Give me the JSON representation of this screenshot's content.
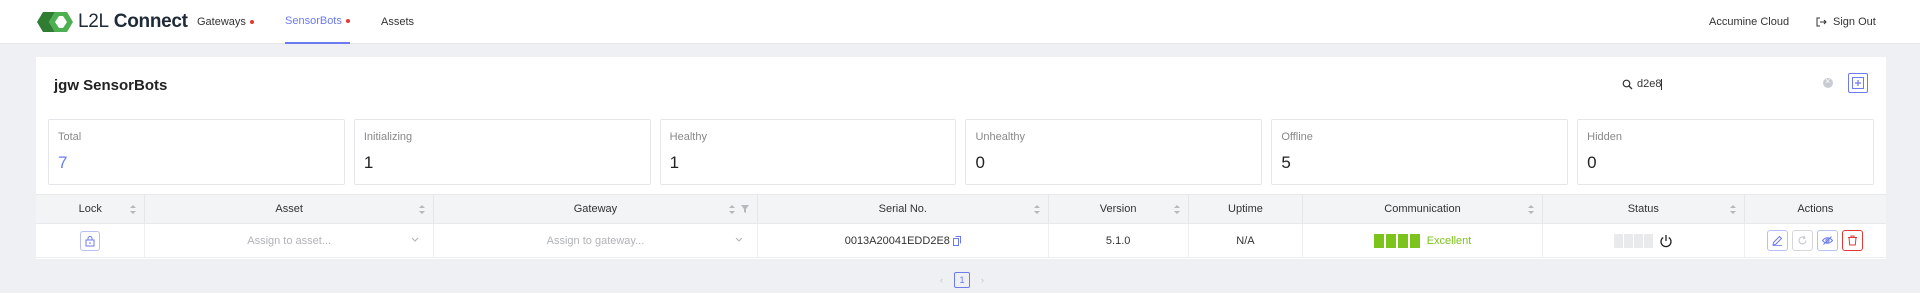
{
  "header": {
    "logo_text_light": "L2L",
    "logo_text_bold": "Connect",
    "nav": [
      {
        "label": "Gateways",
        "has_alert": true
      },
      {
        "label": "SensorBots",
        "has_alert": true,
        "active": true
      },
      {
        "label": "Assets",
        "has_alert": false
      }
    ],
    "account": "Accumine Cloud",
    "signout": "Sign Out"
  },
  "panel": {
    "title": "jgw SensorBots",
    "search_value": "d2e8"
  },
  "stats": [
    {
      "label": "Total",
      "value": "7"
    },
    {
      "label": "Initializing",
      "value": "1"
    },
    {
      "label": "Healthy",
      "value": "1"
    },
    {
      "label": "Unhealthy",
      "value": "0"
    },
    {
      "label": "Offline",
      "value": "5"
    },
    {
      "label": "Hidden",
      "value": "0"
    }
  ],
  "table": {
    "columns": [
      "Lock",
      "Asset",
      "Gateway",
      "Serial No.",
      "Version",
      "Uptime",
      "Communication",
      "Status",
      "Actions"
    ],
    "rows": [
      {
        "asset_placeholder": "Assign to asset...",
        "gateway_placeholder": "Assign to gateway...",
        "serial": "0013A20041EDD2E8",
        "version": "5.1.0",
        "uptime": "N/A",
        "communication": "Excellent",
        "signal_level": 4
      }
    ]
  },
  "pagination": {
    "current": "1",
    "prev": "‹",
    "next": "›"
  },
  "colors": {
    "accent": "#6c7bf0",
    "alert": "#e53935",
    "good": "#7cc41c"
  },
  "icons": [
    "logo-icon",
    "search-icon",
    "clear-icon",
    "add-icon",
    "lock-icon",
    "chevron-down-icon",
    "copy-icon",
    "power-icon",
    "edit-icon",
    "refresh-icon",
    "hide-icon",
    "trash-icon",
    "signout-icon",
    "sort-icon",
    "filter-icon"
  ]
}
